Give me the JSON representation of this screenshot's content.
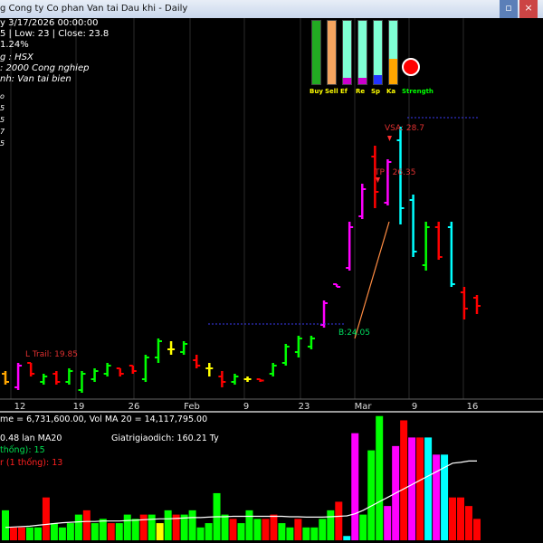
{
  "window": {
    "title": "g Cong ty Co phan Van tai Dau khi - Daily",
    "close_label": "×",
    "restore_label": "▫"
  },
  "header": {
    "date_line": "y 3/17/2026 00:00:00",
    "ohlc_line": "5 | Low: 23 | Close: 23.8",
    "change_line": "1.24%",
    "exchange_line": "g : HSX",
    "industry_line": ": 2000 Cong nghiep",
    "sector_line": "nh: Van tai bien",
    "side_labels": [
      "o",
      "5",
      "5",
      "7",
      "5"
    ]
  },
  "indicator_panel": {
    "labels": [
      "Buy",
      "Sell",
      "Ef",
      "Re",
      "Sp",
      "Ka",
      "Strength"
    ],
    "colors": [
      "#4caf50",
      "#f4a460",
      "#7fffd4",
      "#7fffd4",
      "#7fffd4",
      "#7fffd4"
    ],
    "strength_color": "#ff0000"
  },
  "annotations": {
    "vsa": "VSA: 28.7",
    "tp": "TP   : 26.35",
    "bottom": "B:24.05",
    "trail": "L Trail: 19.85"
  },
  "axis": {
    "x_labels": [
      "12",
      "19",
      "26",
      "Feb",
      "9",
      "23",
      "Mar",
      "9",
      "16"
    ]
  },
  "volume_panel": {
    "header": "me = 6,731,600.00, Vol MA 20 = 14,117,795.00",
    "ratio": "0.48 lan MA20",
    "giatri": "Giatrigiaodich: 160.21 Ty",
    "up": "thống): 15",
    "down": "r (1 thống): 13"
  },
  "chart_data": [
    {
      "type": "candlestick",
      "title": "Cong ty Co phan Van tai Dau khi - Daily",
      "x": [
        "12",
        "19",
        "26",
        "Feb",
        "9",
        "23",
        "Mar",
        "9",
        "16"
      ],
      "series": [
        {
          "color": "#ffa500",
          "low": 19.8,
          "high": 20.3,
          "open": 20.2,
          "close": 19.9
        },
        {
          "color": "#ff00ff",
          "low": 19.6,
          "high": 20.6,
          "open": 19.7,
          "close": 20.5
        },
        {
          "color": "#ff0000",
          "low": 20.1,
          "high": 20.6,
          "open": 20.6,
          "close": 20.2
        },
        {
          "color": "#00ff00",
          "low": 19.8,
          "high": 20.2,
          "open": 19.9,
          "close": 20.1
        },
        {
          "color": "#ff0000",
          "low": 19.8,
          "high": 20.3,
          "open": 20.2,
          "close": 19.9
        },
        {
          "color": "#00ff00",
          "low": 19.8,
          "high": 20.4,
          "open": 19.9,
          "close": 20.3
        },
        {
          "color": "#00ff00",
          "low": 19.5,
          "high": 20.3,
          "open": 19.6,
          "close": 20.2
        },
        {
          "color": "#00ff00",
          "low": 19.9,
          "high": 20.4,
          "open": 20.0,
          "close": 20.3
        },
        {
          "color": "#00ff00",
          "low": 20.1,
          "high": 20.6,
          "open": 20.2,
          "close": 20.5
        },
        {
          "color": "#ff0000",
          "low": 20.1,
          "high": 20.4,
          "open": 20.4,
          "close": 20.2
        },
        {
          "color": "#ff0000",
          "low": 20.2,
          "high": 20.5,
          "open": 20.5,
          "close": 20.3
        },
        {
          "color": "#00ff00",
          "low": 19.9,
          "high": 20.9,
          "open": 20.0,
          "close": 20.8
        },
        {
          "color": "#00ff00",
          "low": 20.6,
          "high": 21.5,
          "open": 20.8,
          "close": 21.4
        },
        {
          "color": "#ffff00",
          "low": 20.9,
          "high": 21.4,
          "open": 21.1,
          "close": 21.1
        },
        {
          "color": "#00ff00",
          "low": 20.9,
          "high": 21.4,
          "open": 21.0,
          "close": 21.3
        },
        {
          "color": "#ff0000",
          "low": 20.4,
          "high": 20.9,
          "open": 20.7,
          "close": 20.5
        },
        {
          "color": "#ffff00",
          "low": 20.1,
          "high": 20.6,
          "open": 20.4,
          "close": 20.4
        },
        {
          "color": "#ff0000",
          "low": 19.7,
          "high": 20.3,
          "open": 20.1,
          "close": 19.9
        },
        {
          "color": "#00ff00",
          "low": 19.8,
          "high": 20.2,
          "open": 19.9,
          "close": 20.1
        },
        {
          "color": "#ffff00",
          "low": 19.9,
          "high": 20.1,
          "open": 20.0,
          "close": 20.0
        },
        {
          "color": "#ff0000",
          "low": 19.9,
          "high": 20.0,
          "open": 20.0,
          "close": 19.95
        },
        {
          "color": "#00ff00",
          "low": 20.1,
          "high": 20.6,
          "open": 20.2,
          "close": 20.5
        },
        {
          "color": "#00ff00",
          "low": 20.5,
          "high": 21.3,
          "open": 20.6,
          "close": 21.2
        },
        {
          "color": "#00ff00",
          "low": 20.8,
          "high": 21.6,
          "open": 21.0,
          "close": 21.5
        },
        {
          "color": "#00ff00",
          "low": 21.1,
          "high": 21.6,
          "open": 21.2,
          "close": 21.5
        },
        {
          "color": "#ff00ff",
          "low": 21.9,
          "high": 22.9,
          "open": 22.0,
          "close": 22.8
        },
        {
          "color": "#ff00ff",
          "low": 23.4,
          "high": 23.5,
          "open": 23.5,
          "close": 23.4
        },
        {
          "color": "#ff00ff",
          "low": 24.0,
          "high": 25.8,
          "open": 24.1,
          "close": 25.6
        },
        {
          "color": "#ff00ff",
          "low": 25.9,
          "high": 27.2,
          "open": 26.0,
          "close": 27.0
        },
        {
          "color": "#ff0000",
          "low": 26.3,
          "high": 28.6,
          "open": 28.2,
          "close": 26.9
        },
        {
          "color": "#ff00ff",
          "low": 26.4,
          "high": 28.1,
          "open": 26.5,
          "close": 28.0
        },
        {
          "color": "#00ffff",
          "low": 25.7,
          "high": 29.3,
          "open": 28.8,
          "close": 26.3
        },
        {
          "color": "#00ffff",
          "low": 24.5,
          "high": 26.8,
          "open": 26.6,
          "close": 24.7
        },
        {
          "color": "#00ff00",
          "low": 24.0,
          "high": 25.8,
          "open": 24.2,
          "close": 25.6
        },
        {
          "color": "#ff0000",
          "low": 24.4,
          "high": 25.8,
          "open": 25.6,
          "close": 24.5
        },
        {
          "color": "#00ffff",
          "low": 23.4,
          "high": 25.8,
          "open": 25.6,
          "close": 23.5
        },
        {
          "color": "#ff0000",
          "low": 22.2,
          "high": 23.4,
          "open": 23.2,
          "close": 22.6
        },
        {
          "color": "#ff0000",
          "low": 22.4,
          "high": 23.1,
          "open": 23.0,
          "close": 22.7
        }
      ],
      "ylim": [
        19.3,
        29.8
      ]
    },
    {
      "type": "bar",
      "title": "Volume",
      "colors": [
        "#00ff00",
        "#ff0000",
        "#ff0000",
        "#00ff00",
        "#00ff00",
        "#ff0000",
        "#00ff00",
        "#00ff00",
        "#00ff00",
        "#00ff00",
        "#ff0000",
        "#00ff00",
        "#00ff00",
        "#ff0000",
        "#00ff00",
        "#00ff00",
        "#00ff00",
        "#ff0000",
        "#00ff00",
        "#ffff00",
        "#00ff00",
        "#ff0000",
        "#00ff00",
        "#00ff00",
        "#00ff00",
        "#00ff00",
        "#00ff00",
        "#00ff00",
        "#ff0000",
        "#00ff00",
        "#00ff00",
        "#00ff00",
        "#ff0000",
        "#ff0000",
        "#00ff00",
        "#00ff00",
        "#ff0000",
        "#00ff00",
        "#00ff00",
        "#00ff00",
        "#00ff00",
        "#ff0000",
        "#00ffff",
        "#ff00ff",
        "#00ff00",
        "#00ff00",
        "#00ff00",
        "#ff00ff",
        "#ff00ff",
        "#ff0000",
        "#ff00ff",
        "#ff0000",
        "#00ffff",
        "#ff00ff",
        "#00ffff",
        "#ff0000",
        "#ff0000",
        "#ff0000",
        "#ff0000"
      ],
      "values": [
        7,
        3,
        3,
        3,
        3,
        10,
        4,
        3,
        4,
        6,
        7,
        4,
        5,
        4,
        4,
        6,
        5,
        6,
        6,
        4,
        7,
        6,
        6,
        7,
        3,
        4,
        11,
        6,
        5,
        4,
        7,
        5,
        5,
        6,
        4,
        3,
        5,
        3,
        3,
        5,
        7,
        9,
        1,
        25,
        6,
        21,
        29,
        8,
        22,
        28,
        24,
        24,
        24,
        20,
        20,
        10,
        10,
        8,
        5
      ],
      "ma": [
        3,
        3.1,
        3.2,
        3.3,
        3.5,
        3.7,
        3.9,
        4.1,
        4.2,
        4.3,
        4.4,
        4.4,
        4.5,
        4.5,
        4.5,
        4.6,
        4.7,
        4.8,
        4.9,
        5.0,
        5.0,
        5.1,
        5.2,
        5.3,
        5.3,
        5.4,
        5.5,
        5.5,
        5.6,
        5.6,
        5.6,
        5.6,
        5.6,
        5.6,
        5.6,
        5.5,
        5.5,
        5.4,
        5.4,
        5.4,
        5.5,
        5.6,
        5.7,
        6.2,
        7,
        8,
        9,
        10,
        11,
        12,
        13,
        14,
        15,
        16,
        17,
        18,
        18.2,
        18.5,
        18.5
      ],
      "ylim": [
        0,
        30
      ]
    }
  ]
}
